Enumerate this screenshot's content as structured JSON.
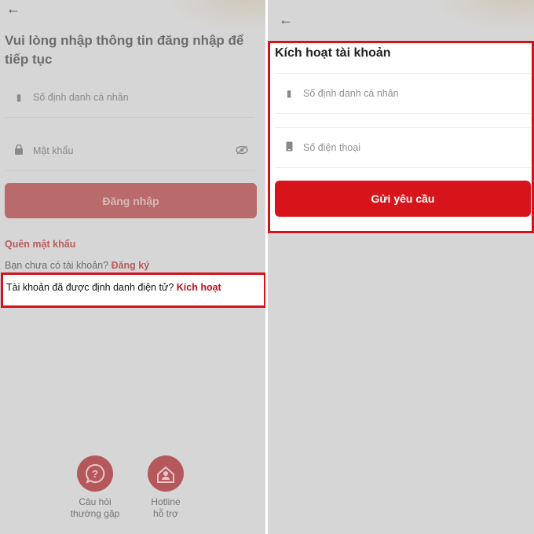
{
  "login_screen": {
    "title": "Vui lòng nhập thông tin đăng nhập để tiếp tục",
    "id_field": {
      "icon": "id-card-icon",
      "placeholder": "Số định danh cá nhân"
    },
    "password_field": {
      "icon": "lock-icon",
      "placeholder": "Mật khẩu",
      "toggle_icon": "eye-off-icon"
    },
    "login_button": "Đăng nhập",
    "forgot_password": "Quên mật khẩu",
    "register_prompt": "Bạn chưa có tài khoản?",
    "register_link": "Đăng ký",
    "activate_prompt": "Tài khoản đã được định danh điện tử?",
    "activate_link": "Kích hoạt",
    "help_items": [
      {
        "icon": "question-bubble-icon",
        "label_line1": "Câu hỏi",
        "label_line2": "thường gặp"
      },
      {
        "icon": "hotline-icon",
        "label_line1": "Hotline",
        "label_line2": "hỗ trợ"
      }
    ]
  },
  "activation_screen": {
    "title": "Kích hoạt tài khoản",
    "id_field": {
      "icon": "id-card-icon",
      "placeholder": "Số định danh cá nhân"
    },
    "phone_field": {
      "icon": "phone-icon",
      "placeholder": "Số điện thoại"
    },
    "submit_button": "Gửi yêu cầu"
  },
  "colors": {
    "accent_red": "#d8141b",
    "highlight_border": "#d3141b",
    "overlay_grey": "#d6d6d6"
  }
}
